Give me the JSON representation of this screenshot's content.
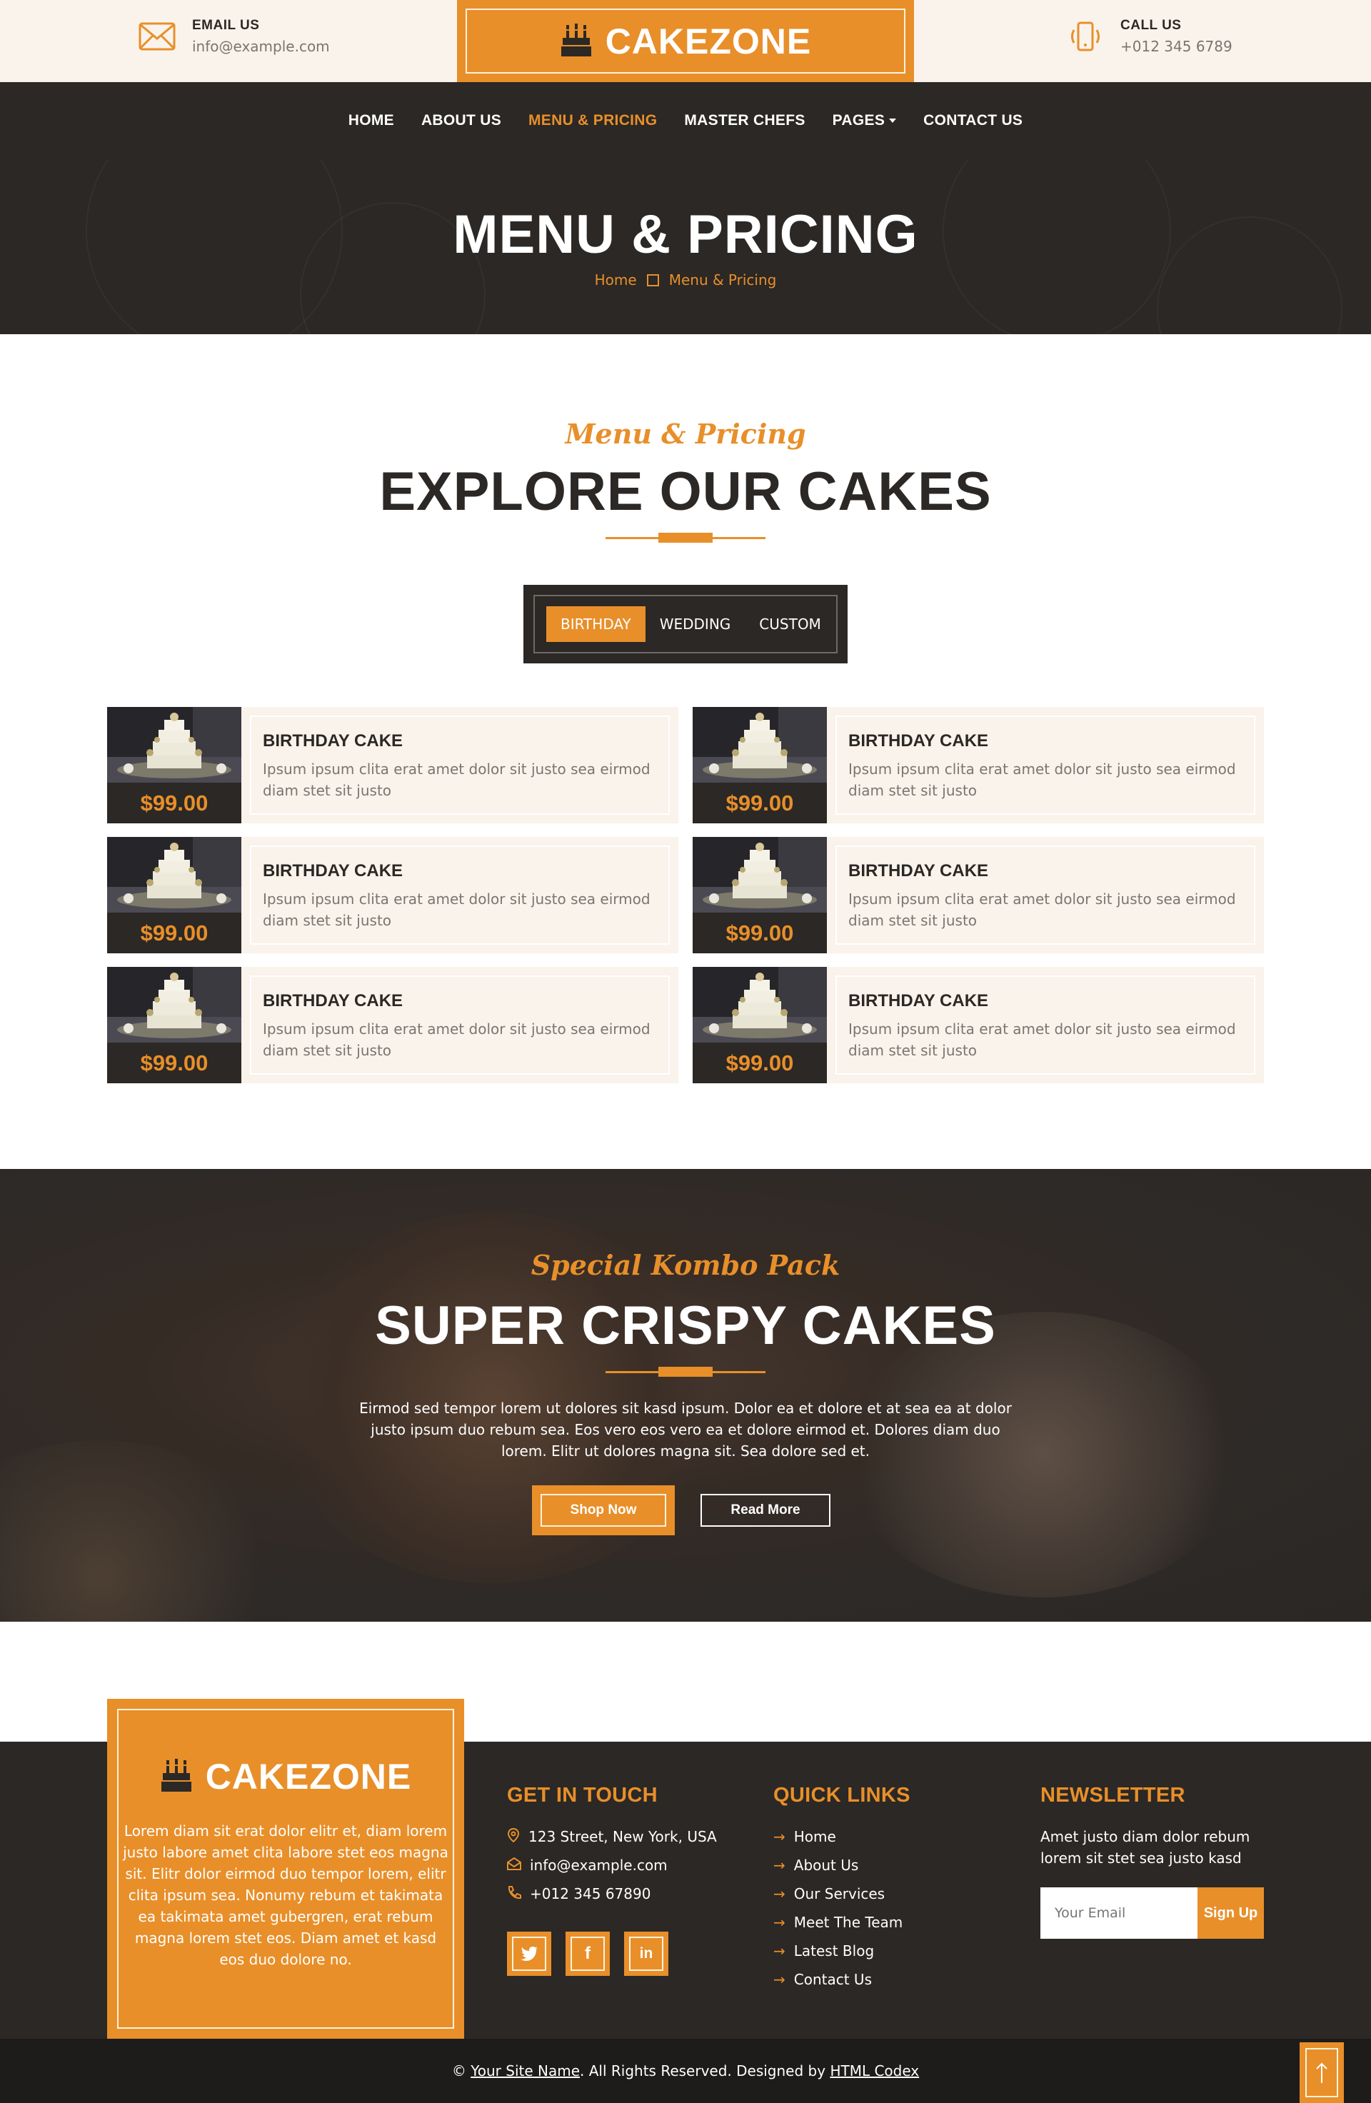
{
  "topbar": {
    "email_label": "EMAIL US",
    "email_value": "info@example.com",
    "call_label": "CALL US",
    "call_value": "+012 345 6789",
    "logo": "CAKEZONE"
  },
  "nav": {
    "items": [
      "HOME",
      "ABOUT US",
      "MENU & PRICING",
      "MASTER CHEFS",
      "PAGES",
      "CONTACT US"
    ],
    "active": "MENU & PRICING"
  },
  "page_header": {
    "title": "MENU & PRICING",
    "breadcrumb": [
      "Home",
      "Menu & Pricing"
    ]
  },
  "menu": {
    "eyebrow": "Menu & Pricing",
    "title": "EXPLORE OUR CAKES",
    "tabs": [
      "BIRTHDAY",
      "WEDDING",
      "CUSTOM"
    ],
    "active_tab": "BIRTHDAY",
    "items": [
      {
        "name": "BIRTHDAY CAKE",
        "desc": "Ipsum ipsum clita erat amet dolor sit justo sea eirmod diam stet sit justo",
        "price": "$99.00"
      },
      {
        "name": "BIRTHDAY CAKE",
        "desc": "Ipsum ipsum clita erat amet dolor sit justo sea eirmod diam stet sit justo",
        "price": "$99.00"
      },
      {
        "name": "BIRTHDAY CAKE",
        "desc": "Ipsum ipsum clita erat amet dolor sit justo sea eirmod diam stet sit justo",
        "price": "$99.00"
      },
      {
        "name": "BIRTHDAY CAKE",
        "desc": "Ipsum ipsum clita erat amet dolor sit justo sea eirmod diam stet sit justo",
        "price": "$99.00"
      },
      {
        "name": "BIRTHDAY CAKE",
        "desc": "Ipsum ipsum clita erat amet dolor sit justo sea eirmod diam stet sit justo",
        "price": "$99.00"
      },
      {
        "name": "BIRTHDAY CAKE",
        "desc": "Ipsum ipsum clita erat amet dolor sit justo sea eirmod diam stet sit justo",
        "price": "$99.00"
      }
    ]
  },
  "kombo": {
    "eyebrow": "Special Kombo Pack",
    "title": "SUPER CRISPY CAKES",
    "text": "Eirmod sed tempor lorem ut dolores sit kasd ipsum. Dolor ea et dolore et at sea ea at dolor justo ipsum duo rebum sea. Eos vero eos vero ea et dolore eirmod et. Dolores diam duo lorem. Elitr ut dolores magna sit. Sea dolore sed et.",
    "btn_primary": "Shop Now",
    "btn_secondary": "Read More"
  },
  "footer": {
    "logo": "CAKEZONE",
    "about": "Lorem diam sit erat dolor elitr et, diam lorem justo labore amet clita labore stet eos magna sit. Elitr dolor eirmod duo tempor lorem, elitr clita ipsum sea. Nonumy rebum et takimata ea takimata amet gubergren, erat rebum magna lorem stet eos. Diam amet et kasd eos duo dolore no.",
    "contact_title": "GET IN TOUCH",
    "address": "123 Street, New York, USA",
    "email": "info@example.com",
    "phone": "+012 345 67890",
    "social_icons": [
      "twitter-icon",
      "facebook-icon",
      "linkedin-icon"
    ],
    "links_title": "QUICK LINKS",
    "links": [
      "Home",
      "About Us",
      "Our Services",
      "Meet The Team",
      "Latest Blog",
      "Contact Us"
    ],
    "newsletter_title": "NEWSLETTER",
    "newsletter_text": "Amet justo diam dolor rebum lorem sit stet sea justo kasd",
    "newsletter_placeholder": "Your Email",
    "newsletter_button": "Sign Up"
  },
  "copyright": {
    "prefix": "©",
    "site_name": "Your Site Name",
    "middle": ". All Rights Reserved. Designed by",
    "designer": "HTML Codex"
  },
  "colors": {
    "accent": "#e88f2a",
    "dark": "#2b2825",
    "cream": "#faf3eb"
  }
}
